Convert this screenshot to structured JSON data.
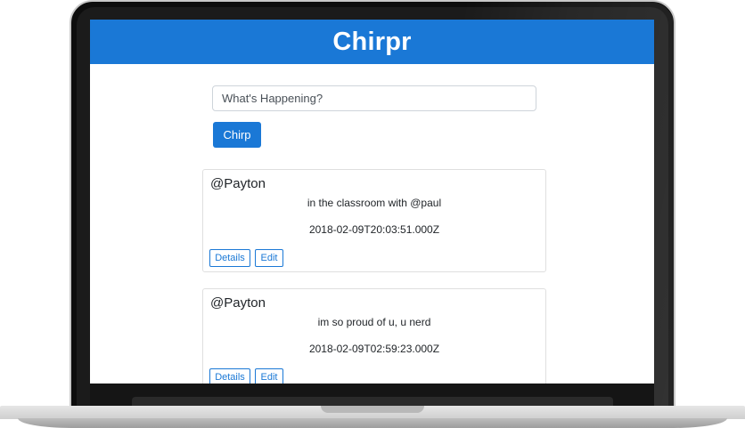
{
  "app": {
    "title": "Chirpr"
  },
  "composer": {
    "placeholder": "What's Happening?",
    "submit_label": "Chirp"
  },
  "chirps": [
    {
      "user": "@Payton",
      "text": "in the classroom with @paul",
      "timestamp": "2018-02-09T20:03:51.000Z",
      "details_label": "Details",
      "edit_label": "Edit"
    },
    {
      "user": "@Payton",
      "text": "im so proud of u, u nerd",
      "timestamp": "2018-02-09T02:59:23.000Z",
      "details_label": "Details",
      "edit_label": "Edit"
    }
  ],
  "colors": {
    "brand": "#1a78d6",
    "card_border": "#dfdfdf"
  }
}
